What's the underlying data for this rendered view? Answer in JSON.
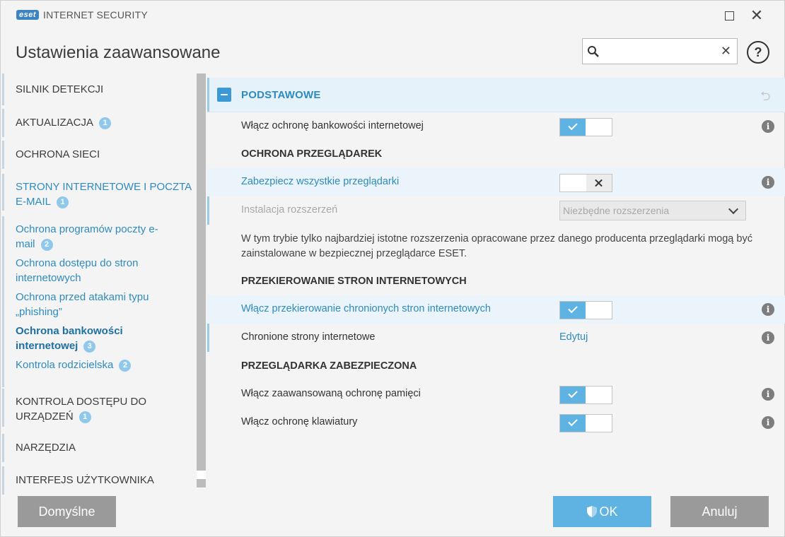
{
  "app": {
    "logo": "eset",
    "title": "INTERNET SECURITY"
  },
  "header": {
    "title": "Ustawienia zaawansowane",
    "search_value": "",
    "help_label": "?"
  },
  "sidebar": {
    "items": [
      {
        "label": "SILNIK DETEKCJI",
        "badge": ""
      },
      {
        "label": "AKTUALIZACJA",
        "badge": "1"
      },
      {
        "label": "OCHRONA SIECI",
        "badge": ""
      },
      {
        "label": "STRONY INTERNETOWE I POCZTA",
        "label2": "E-MAIL",
        "badge": "1"
      },
      {
        "label": "Ochrona programów poczty e-",
        "label2": "mail",
        "badge": "2"
      },
      {
        "label": "Ochrona dostępu do stron",
        "label2": "internetowych"
      },
      {
        "label": "Ochrona przed atakami typu",
        "label2": "„phishing”"
      },
      {
        "label": "Ochrona bankowości",
        "label2": "internetowej",
        "badge": "3"
      },
      {
        "label": "Kontrola rodzicielska",
        "badge": "2"
      },
      {
        "label": "KONTROLA DOSTĘPU DO",
        "label2": "URZĄDZEŃ",
        "badge": "1"
      },
      {
        "label": "NARZĘDZIA"
      },
      {
        "label": "INTERFEJS UŻYTKOWNIKA"
      }
    ]
  },
  "section": {
    "title": "PODSTAWOWE",
    "rows": {
      "enable_banking": {
        "label": "Włącz ochronę bankowości internetowej",
        "state": "on"
      },
      "browsers_head": "OCHRONA PRZEGLĄDAREK",
      "secure_all": {
        "label": "Zabezpiecz wszystkie przeglądarki",
        "state": "off"
      },
      "extensions": {
        "label": "Instalacja rozszerzeń",
        "value": "Niezbędne rozszerzenia"
      },
      "description": "W tym trybie tylko najbardziej istotne rozszerzenia opracowane przez danego producenta przeglądarki mogą być zainstalowane w bezpiecznej przeglądarce ESET.",
      "redirect_head": "PRZEKIEROWANIE STRON INTERNETOWYCH",
      "enable_redirect": {
        "label": "Włącz przekierowanie chronionych stron internetowych",
        "state": "on"
      },
      "protected_sites": {
        "label": "Chronione strony internetowe",
        "link": "Edytuj"
      },
      "secure_browser_head": "PRZEGLĄDARKA ZABEZPIECZONA",
      "memory": {
        "label": "Włącz zaawansowaną ochronę pamięci",
        "state": "on"
      },
      "keyboard": {
        "label": "Włącz ochronę klawiatury",
        "state": "on"
      }
    }
  },
  "footer": {
    "default_label": "Domyślne",
    "ok_label": "OK",
    "cancel_label": "Anuluj"
  },
  "colors": {
    "accent": "#2e8bc0",
    "toggle_on": "#5fb3e3",
    "gray_button": "#9a9a9a"
  }
}
